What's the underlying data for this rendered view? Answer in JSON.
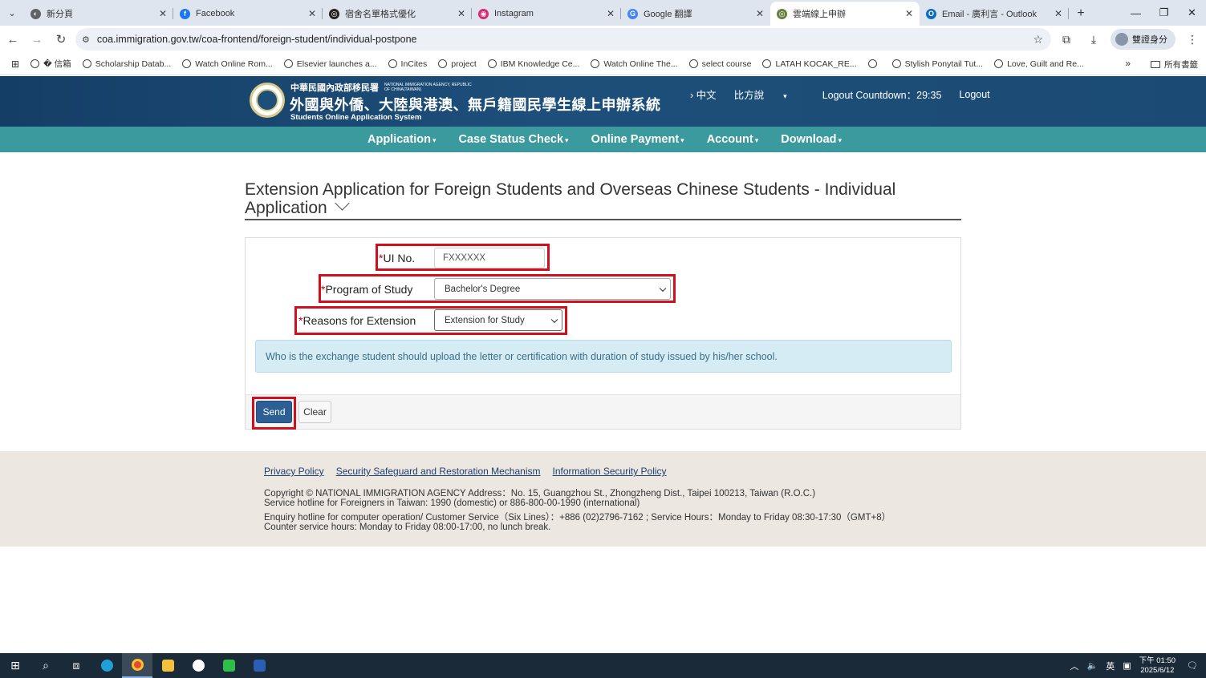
{
  "browser": {
    "tabs": [
      {
        "title": "新分頁",
        "color": "#5f6368",
        "glyph": "◐"
      },
      {
        "title": "Facebook",
        "color": "#1877f2",
        "glyph": "f"
      },
      {
        "title": "宿舍名單格式優化",
        "color": "#222222",
        "glyph": "◎"
      },
      {
        "title": "Instagram",
        "color": "#d62976",
        "glyph": "◉"
      },
      {
        "title": "Google 翻譯",
        "color": "#4285f4",
        "glyph": "G"
      },
      {
        "title": "雲端線上申辦",
        "color": "#6a7f3a",
        "glyph": "◎"
      },
      {
        "title": "Email - 廣利言 - Outlook",
        "color": "#0f6cbd",
        "glyph": "O"
      }
    ],
    "url": "coa.immigration.gov.tw/coa-frontend/foreign-student/individual-postpone",
    "profile_label": "雙證身分",
    "bookmarks": [
      "� 信箱",
      "Scholarship Datab...",
      "Watch Online Rom...",
      "Elsevier launches a...",
      "InCites",
      "project",
      "IBM Knowledge Ce...",
      "Watch Online The...",
      "select course",
      "LATAH KOCAK_RE...",
      "",
      "Stylish Ponytail Tut...",
      "Love, Guilt and Re..."
    ],
    "bookmarks_all": "所有書籤"
  },
  "header": {
    "agency_cn": "中華民國內政部移民署",
    "agency_en": "NATIONAL IMMIGRATION AGENCY, REPUBLIC OF CHINA(TAIWAN)",
    "system_cn": "外國與外僑、大陸與港澳、無戶籍國民學生線上申辦系統",
    "system_en": "Students Online Application System",
    "lang_link": "› 中文",
    "dialect_link": "比方說",
    "countdown": "Logout Countdown：29:35",
    "logout": "Logout"
  },
  "nav": {
    "items": [
      "Application",
      "Case Status Check",
      "Online Payment",
      "Account",
      "Download"
    ]
  },
  "page": {
    "title": "Extension Application for Foreign Students and Overseas Chinese Students - Individual Application"
  },
  "form": {
    "ui_no_label": "UI No.",
    "ui_no_value": "FXXXXXX",
    "program_label": "Program of Study",
    "program_value": "Bachelor's Degree",
    "reason_label": "Reasons for Extension",
    "reason_value": "Extension for Study",
    "required_mark": "*",
    "notice": "Who is the exchange student should upload the letter or certification with duration of study issued by his/her school.",
    "send": "Send",
    "clear": "Clear",
    "highlight_color": "#d20f1c"
  },
  "footer": {
    "links": [
      "Privacy Policy",
      "Security Safeguard and Restoration Mechanism",
      "Information Security Policy"
    ],
    "lines": [
      "Copyright © NATIONAL IMMIGRATION AGENCY Address：No. 15, Guangzhou St., Zhongzheng Dist., Taipei 100213, Taiwan (R.O.C.)",
      "Service hotline for Foreigners in Taiwan: 1990 (domestic) or 886-800-00-1990 (international)",
      "Enquiry hotline for computer operation/ Customer Service（Six Lines）：+886 (02)2796-7162 ; Service Hours：Monday to Friday 08:30-17:30（GMT+8）",
      "Counter service hours: Monday to Friday 08:00-17:00, no lunch break."
    ]
  },
  "taskbar": {
    "ime": "英",
    "time": "下午 01:50",
    "date": "2025/6/12"
  }
}
